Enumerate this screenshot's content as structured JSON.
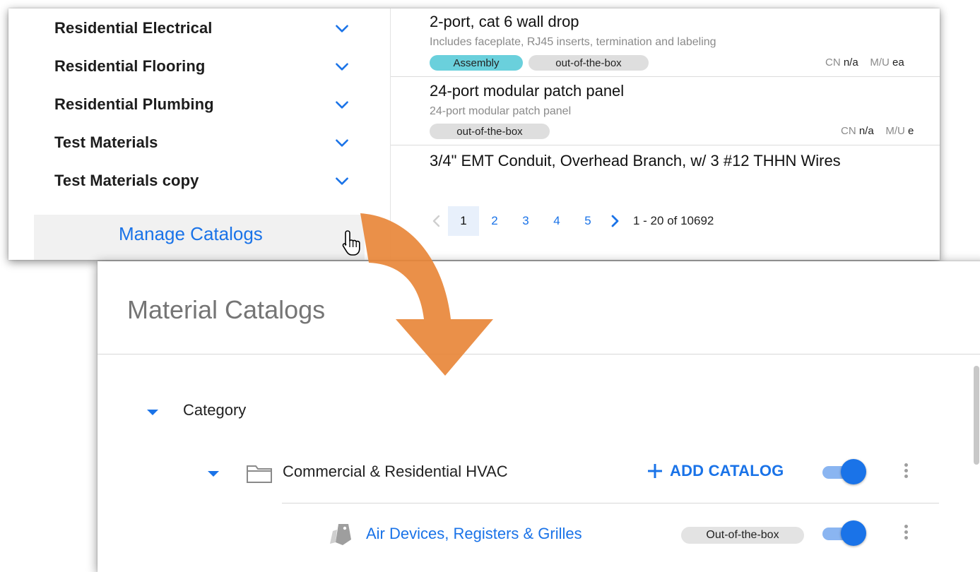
{
  "sidebar": {
    "categories": [
      {
        "label": "Residential Electrical"
      },
      {
        "label": "Residential Flooring"
      },
      {
        "label": "Residential Plumbing"
      },
      {
        "label": "Test Materials"
      },
      {
        "label": "Test Materials copy"
      }
    ],
    "manage_label": "Manage Catalogs"
  },
  "products": [
    {
      "title": "2-port, cat 6 wall drop",
      "description": "Includes faceplate, RJ45 inserts, termination and labeling",
      "chips": [
        "Assembly",
        "out-of-the-box"
      ],
      "cn_label": "CN",
      "cn_value": "n/a",
      "mu_label": "M/U",
      "mu_value": "ea"
    },
    {
      "title": "24-port modular patch panel",
      "description": "24-port modular patch panel",
      "chips": [
        "out-of-the-box"
      ],
      "cn_label": "CN",
      "cn_value": "n/a",
      "mu_label": "M/U",
      "mu_value": "e"
    },
    {
      "title": "3/4\" EMT Conduit, Overhead Branch, w/ 3 #12 THHN Wires"
    }
  ],
  "pagination": {
    "pages": [
      "1",
      "2",
      "3",
      "4",
      "5"
    ],
    "active": "1",
    "range_text": "1 - 20 of 10692"
  },
  "catalogs_panel": {
    "title": "Material Catalogs",
    "category_heading": "Category",
    "group": {
      "label": "Commercial & Residential HVAC",
      "add_label": "ADD CATALOG",
      "enabled": true
    },
    "catalog": {
      "label": "Air Devices, Registers & Grilles",
      "badge": "Out-of-the-box",
      "enabled": true
    }
  },
  "colors": {
    "accent": "#1a73e8",
    "toggle_track": "#8ab5f1",
    "assembly_chip": "#6ad0dc",
    "arrow": "#e8873a"
  },
  "icons": [
    "chevron-down-icon",
    "hand-cursor-icon",
    "chevron-left-icon",
    "chevron-right-icon",
    "caret-down-icon",
    "folder-icon",
    "plus-icon",
    "tag-icon",
    "more-vert-icon",
    "curved-arrow-icon"
  ]
}
